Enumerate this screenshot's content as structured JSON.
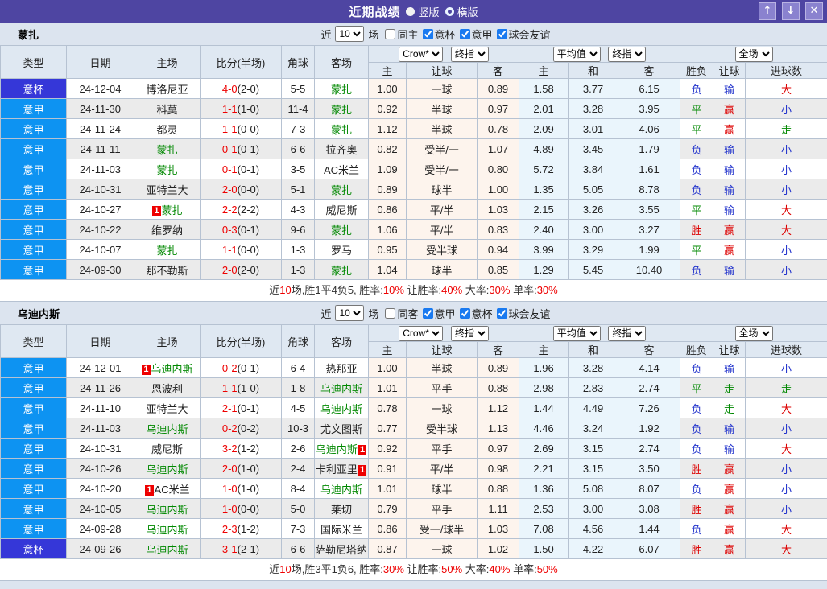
{
  "titlebar": {
    "title": "近期战绩",
    "vertical_label": "竖版",
    "horizontal_label": "横版",
    "up_button": "↑",
    "down_button": "↓",
    "close_button": "✕"
  },
  "table_header": {
    "type": "类型",
    "date": "日期",
    "home": "主场",
    "score": "比分(半场)",
    "corner": "角球",
    "away": "客场",
    "odds_selects": {
      "book": "Crow*",
      "book_stage": "终指",
      "avg": "平均值",
      "avg_stage": "终指",
      "scope": "全场"
    },
    "sub": {
      "h": "主",
      "hcp": "让球",
      "a": "客",
      "h2": "主",
      "d": "和",
      "a2": "客",
      "wdl": "胜负",
      "hcp_res": "让球",
      "goals": "进球数"
    }
  },
  "sections": [
    {
      "team": "蒙扎",
      "filter": {
        "near": "近",
        "count": "10",
        "games": "场",
        "checks": [
          {
            "label": "同主",
            "checked": false
          },
          {
            "label": "意杯",
            "checked": true
          },
          {
            "label": "意甲",
            "checked": true
          },
          {
            "label": "球会友谊",
            "checked": true
          }
        ]
      },
      "rows": [
        {
          "type": "意杯",
          "type_style": "cup",
          "date": "24-12-04",
          "home": {
            "name": "博洛尼亚",
            "team": false
          },
          "score": "4-0",
          "half": "(2-0)",
          "corner": "5-5",
          "away": {
            "name": "蒙扎",
            "team": true
          },
          "hcp": [
            "1.00",
            "一球",
            "0.89"
          ],
          "avg": [
            "1.58",
            "3.77",
            "6.15"
          ],
          "res": [
            {
              "t": "负",
              "c": "b"
            },
            {
              "t": "输",
              "c": "b"
            },
            {
              "t": "大",
              "c": "r"
            }
          ]
        },
        {
          "type": "意甲",
          "type_style": "league",
          "date": "24-11-30",
          "home": {
            "name": "科莫",
            "team": false
          },
          "score": "1-1",
          "half": "(1-0)",
          "corner": "11-4",
          "away": {
            "name": "蒙扎",
            "team": true
          },
          "hcp": [
            "0.92",
            "半球",
            "0.97"
          ],
          "avg": [
            "2.01",
            "3.28",
            "3.95"
          ],
          "res": [
            {
              "t": "平",
              "c": "g"
            },
            {
              "t": "赢",
              "c": "r"
            },
            {
              "t": "小",
              "c": "b"
            }
          ]
        },
        {
          "type": "意甲",
          "type_style": "league",
          "date": "24-11-24",
          "home": {
            "name": "都灵",
            "team": false
          },
          "score": "1-1",
          "half": "(0-0)",
          "corner": "7-3",
          "away": {
            "name": "蒙扎",
            "team": true
          },
          "hcp": [
            "1.12",
            "半球",
            "0.78"
          ],
          "avg": [
            "2.09",
            "3.01",
            "4.06"
          ],
          "res": [
            {
              "t": "平",
              "c": "g"
            },
            {
              "t": "赢",
              "c": "r"
            },
            {
              "t": "走",
              "c": "g"
            }
          ]
        },
        {
          "type": "意甲",
          "type_style": "league",
          "date": "24-11-11",
          "home": {
            "name": "蒙扎",
            "team": true
          },
          "score": "0-1",
          "half": "(0-1)",
          "corner": "6-6",
          "away": {
            "name": "拉齐奥",
            "team": false
          },
          "hcp": [
            "0.82",
            "受半/一",
            "1.07"
          ],
          "avg": [
            "4.89",
            "3.45",
            "1.79"
          ],
          "res": [
            {
              "t": "负",
              "c": "b"
            },
            {
              "t": "输",
              "c": "b"
            },
            {
              "t": "小",
              "c": "b"
            }
          ]
        },
        {
          "type": "意甲",
          "type_style": "league",
          "date": "24-11-03",
          "home": {
            "name": "蒙扎",
            "team": true
          },
          "score": "0-1",
          "half": "(0-1)",
          "corner": "3-5",
          "away": {
            "name": "AC米兰",
            "team": false
          },
          "hcp": [
            "1.09",
            "受半/一",
            "0.80"
          ],
          "avg": [
            "5.72",
            "3.84",
            "1.61"
          ],
          "res": [
            {
              "t": "负",
              "c": "b"
            },
            {
              "t": "输",
              "c": "b"
            },
            {
              "t": "小",
              "c": "b"
            }
          ]
        },
        {
          "type": "意甲",
          "type_style": "league",
          "date": "24-10-31",
          "home": {
            "name": "亚特兰大",
            "team": false
          },
          "score": "2-0",
          "half": "(0-0)",
          "corner": "5-1",
          "away": {
            "name": "蒙扎",
            "team": true
          },
          "hcp": [
            "0.89",
            "球半",
            "1.00"
          ],
          "avg": [
            "1.35",
            "5.05",
            "8.78"
          ],
          "res": [
            {
              "t": "负",
              "c": "b"
            },
            {
              "t": "输",
              "c": "b"
            },
            {
              "t": "小",
              "c": "b"
            }
          ]
        },
        {
          "type": "意甲",
          "type_style": "league",
          "date": "24-10-27",
          "home": {
            "name": "蒙扎",
            "team": true,
            "badge": "1",
            "badge_pos": "left"
          },
          "score": "2-2",
          "half": "(2-2)",
          "corner": "4-3",
          "away": {
            "name": "威尼斯",
            "team": false
          },
          "hcp": [
            "0.86",
            "平/半",
            "1.03"
          ],
          "avg": [
            "2.15",
            "3.26",
            "3.55"
          ],
          "res": [
            {
              "t": "平",
              "c": "g"
            },
            {
              "t": "输",
              "c": "b"
            },
            {
              "t": "大",
              "c": "r"
            }
          ]
        },
        {
          "type": "意甲",
          "type_style": "league",
          "date": "24-10-22",
          "home": {
            "name": "维罗纳",
            "team": false
          },
          "score": "0-3",
          "half": "(0-1)",
          "corner": "9-6",
          "away": {
            "name": "蒙扎",
            "team": true
          },
          "hcp": [
            "1.06",
            "平/半",
            "0.83"
          ],
          "avg": [
            "2.40",
            "3.00",
            "3.27"
          ],
          "res": [
            {
              "t": "胜",
              "c": "r"
            },
            {
              "t": "赢",
              "c": "r"
            },
            {
              "t": "大",
              "c": "r"
            }
          ]
        },
        {
          "type": "意甲",
          "type_style": "league",
          "date": "24-10-07",
          "home": {
            "name": "蒙扎",
            "team": true
          },
          "score": "1-1",
          "half": "(0-0)",
          "corner": "1-3",
          "away": {
            "name": "罗马",
            "team": false
          },
          "hcp": [
            "0.95",
            "受半球",
            "0.94"
          ],
          "avg": [
            "3.99",
            "3.29",
            "1.99"
          ],
          "res": [
            {
              "t": "平",
              "c": "g"
            },
            {
              "t": "赢",
              "c": "r"
            },
            {
              "t": "小",
              "c": "b"
            }
          ]
        },
        {
          "type": "意甲",
          "type_style": "league",
          "date": "24-09-30",
          "home": {
            "name": "那不勒斯",
            "team": false
          },
          "score": "2-0",
          "half": "(2-0)",
          "corner": "1-3",
          "away": {
            "name": "蒙扎",
            "team": true
          },
          "hcp": [
            "1.04",
            "球半",
            "0.85"
          ],
          "avg": [
            "1.29",
            "5.45",
            "10.40"
          ],
          "res": [
            {
              "t": "负",
              "c": "b"
            },
            {
              "t": "输",
              "c": "b"
            },
            {
              "t": "小",
              "c": "b"
            }
          ]
        }
      ],
      "summary": [
        {
          "t": "近",
          "c": "k"
        },
        {
          "t": "10",
          "c": "r"
        },
        {
          "t": "场,胜1平4负5, 胜率:",
          "c": "k"
        },
        {
          "t": "10%",
          "c": "r"
        },
        {
          "t": " 让胜率:",
          "c": "k"
        },
        {
          "t": "40%",
          "c": "r"
        },
        {
          "t": " 大率:",
          "c": "k"
        },
        {
          "t": "30%",
          "c": "r"
        },
        {
          "t": " 单率:",
          "c": "k"
        },
        {
          "t": "30%",
          "c": "r"
        }
      ]
    },
    {
      "team": "乌迪内斯",
      "filter": {
        "near": "近",
        "count": "10",
        "games": "场",
        "checks": [
          {
            "label": "同客",
            "checked": false
          },
          {
            "label": "意甲",
            "checked": true
          },
          {
            "label": "意杯",
            "checked": true
          },
          {
            "label": "球会友谊",
            "checked": true
          }
        ]
      },
      "rows": [
        {
          "type": "意甲",
          "type_style": "league",
          "date": "24-12-01",
          "home": {
            "name": "乌迪内斯",
            "team": true,
            "badge": "1",
            "badge_pos": "left"
          },
          "score": "0-2",
          "half": "(0-1)",
          "corner": "6-4",
          "away": {
            "name": "热那亚",
            "team": false
          },
          "hcp": [
            "1.00",
            "半球",
            "0.89"
          ],
          "avg": [
            "1.96",
            "3.28",
            "4.14"
          ],
          "res": [
            {
              "t": "负",
              "c": "b"
            },
            {
              "t": "输",
              "c": "b"
            },
            {
              "t": "小",
              "c": "b"
            }
          ]
        },
        {
          "type": "意甲",
          "type_style": "league",
          "date": "24-11-26",
          "home": {
            "name": "恩波利",
            "team": false
          },
          "score": "1-1",
          "half": "(1-0)",
          "corner": "1-8",
          "away": {
            "name": "乌迪内斯",
            "team": true
          },
          "hcp": [
            "1.01",
            "平手",
            "0.88"
          ],
          "avg": [
            "2.98",
            "2.83",
            "2.74"
          ],
          "res": [
            {
              "t": "平",
              "c": "g"
            },
            {
              "t": "走",
              "c": "g"
            },
            {
              "t": "走",
              "c": "g"
            }
          ]
        },
        {
          "type": "意甲",
          "type_style": "league",
          "date": "24-11-10",
          "home": {
            "name": "亚特兰大",
            "team": false
          },
          "score": "2-1",
          "half": "(0-1)",
          "corner": "4-5",
          "away": {
            "name": "乌迪内斯",
            "team": true
          },
          "hcp": [
            "0.78",
            "一球",
            "1.12"
          ],
          "avg": [
            "1.44",
            "4.49",
            "7.26"
          ],
          "res": [
            {
              "t": "负",
              "c": "b"
            },
            {
              "t": "走",
              "c": "g"
            },
            {
              "t": "大",
              "c": "r"
            }
          ]
        },
        {
          "type": "意甲",
          "type_style": "league",
          "date": "24-11-03",
          "home": {
            "name": "乌迪内斯",
            "team": true
          },
          "score": "0-2",
          "half": "(0-2)",
          "corner": "10-3",
          "away": {
            "name": "尤文图斯",
            "team": false
          },
          "hcp": [
            "0.77",
            "受半球",
            "1.13"
          ],
          "avg": [
            "4.46",
            "3.24",
            "1.92"
          ],
          "res": [
            {
              "t": "负",
              "c": "b"
            },
            {
              "t": "输",
              "c": "b"
            },
            {
              "t": "小",
              "c": "b"
            }
          ]
        },
        {
          "type": "意甲",
          "type_style": "league",
          "date": "24-10-31",
          "home": {
            "name": "威尼斯",
            "team": false
          },
          "score": "3-2",
          "half": "(1-2)",
          "corner": "2-6",
          "away": {
            "name": "乌迪内斯",
            "team": true,
            "badge": "1",
            "badge_pos": "right"
          },
          "hcp": [
            "0.92",
            "平手",
            "0.97"
          ],
          "avg": [
            "2.69",
            "3.15",
            "2.74"
          ],
          "res": [
            {
              "t": "负",
              "c": "b"
            },
            {
              "t": "输",
              "c": "b"
            },
            {
              "t": "大",
              "c": "r"
            }
          ]
        },
        {
          "type": "意甲",
          "type_style": "league",
          "date": "24-10-26",
          "home": {
            "name": "乌迪内斯",
            "team": true
          },
          "score": "2-0",
          "half": "(1-0)",
          "corner": "2-4",
          "away": {
            "name": "卡利亚里",
            "team": false,
            "badge": "1",
            "badge_pos": "right"
          },
          "hcp": [
            "0.91",
            "平/半",
            "0.98"
          ],
          "avg": [
            "2.21",
            "3.15",
            "3.50"
          ],
          "res": [
            {
              "t": "胜",
              "c": "r"
            },
            {
              "t": "赢",
              "c": "r"
            },
            {
              "t": "小",
              "c": "b"
            }
          ]
        },
        {
          "type": "意甲",
          "type_style": "league",
          "date": "24-10-20",
          "home": {
            "name": "AC米兰",
            "team": false,
            "badge": "1",
            "badge_pos": "left"
          },
          "score": "1-0",
          "half": "(1-0)",
          "corner": "8-4",
          "away": {
            "name": "乌迪内斯",
            "team": true
          },
          "hcp": [
            "1.01",
            "球半",
            "0.88"
          ],
          "avg": [
            "1.36",
            "5.08",
            "8.07"
          ],
          "res": [
            {
              "t": "负",
              "c": "b"
            },
            {
              "t": "赢",
              "c": "r"
            },
            {
              "t": "小",
              "c": "b"
            }
          ]
        },
        {
          "type": "意甲",
          "type_style": "league",
          "date": "24-10-05",
          "home": {
            "name": "乌迪内斯",
            "team": true
          },
          "score": "1-0",
          "half": "(0-0)",
          "corner": "5-0",
          "away": {
            "name": "莱切",
            "team": false
          },
          "hcp": [
            "0.79",
            "平手",
            "1.11"
          ],
          "avg": [
            "2.53",
            "3.00",
            "3.08"
          ],
          "res": [
            {
              "t": "胜",
              "c": "r"
            },
            {
              "t": "赢",
              "c": "r"
            },
            {
              "t": "小",
              "c": "b"
            }
          ]
        },
        {
          "type": "意甲",
          "type_style": "league",
          "date": "24-09-28",
          "home": {
            "name": "乌迪内斯",
            "team": true
          },
          "score": "2-3",
          "half": "(1-2)",
          "corner": "7-3",
          "away": {
            "name": "国际米兰",
            "team": false
          },
          "hcp": [
            "0.86",
            "受一/球半",
            "1.03"
          ],
          "avg": [
            "7.08",
            "4.56",
            "1.44"
          ],
          "res": [
            {
              "t": "负",
              "c": "b"
            },
            {
              "t": "赢",
              "c": "r"
            },
            {
              "t": "大",
              "c": "r"
            }
          ]
        },
        {
          "type": "意杯",
          "type_style": "cup",
          "date": "24-09-26",
          "home": {
            "name": "乌迪内斯",
            "team": true
          },
          "score": "3-1",
          "half": "(2-1)",
          "corner": "6-6",
          "away": {
            "name": "萨勒尼塔纳",
            "team": false,
            "badge": "1",
            "badge_pos": "right"
          },
          "hcp": [
            "0.87",
            "一球",
            "1.02"
          ],
          "avg": [
            "1.50",
            "4.22",
            "6.07"
          ],
          "res": [
            {
              "t": "胜",
              "c": "r"
            },
            {
              "t": "赢",
              "c": "r"
            },
            {
              "t": "大",
              "c": "r"
            }
          ]
        }
      ],
      "summary": [
        {
          "t": "近",
          "c": "k"
        },
        {
          "t": "10",
          "c": "r"
        },
        {
          "t": "场,胜3平1负6, 胜率:",
          "c": "k"
        },
        {
          "t": "30%",
          "c": "r"
        },
        {
          "t": " 让胜率:",
          "c": "k"
        },
        {
          "t": "50%",
          "c": "r"
        },
        {
          "t": " 大率:",
          "c": "k"
        },
        {
          "t": "40%",
          "c": "r"
        },
        {
          "t": " 单率:",
          "c": "k"
        },
        {
          "t": "50%",
          "c": "r"
        }
      ]
    }
  ]
}
